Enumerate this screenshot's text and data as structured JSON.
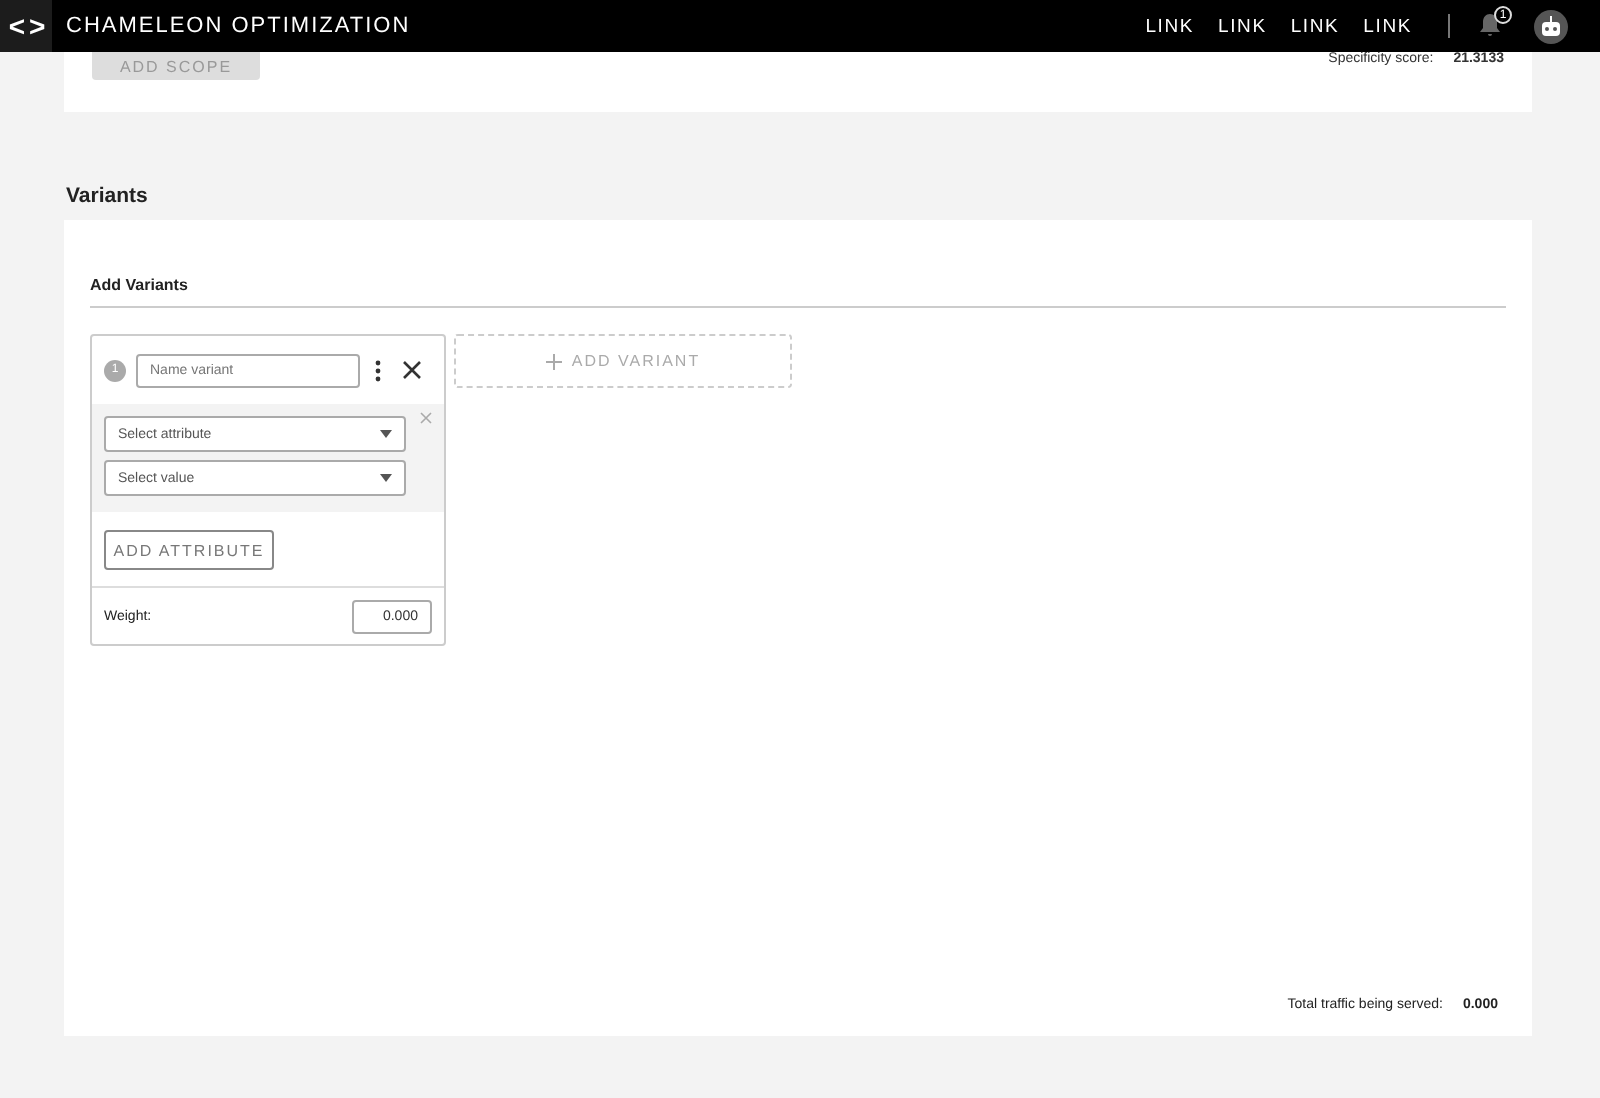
{
  "header": {
    "logo": "< >",
    "title": "CHAMELEON OPTIMIZATION",
    "links": [
      "LINK",
      "LINK",
      "LINK",
      "LINK"
    ],
    "notification_badge": "1"
  },
  "scope": {
    "add_scope_button": "ADD SCOPE",
    "specificity_label": "Specificity score:",
    "specificity_value": "21.3133"
  },
  "variants": {
    "heading": "Variants",
    "subheading": "Add Variants",
    "cards": [
      {
        "number": "1",
        "name_placeholder": "Name variant",
        "attributes": [
          {
            "attribute_placeholder": "Select attribute",
            "value_placeholder": "Select value"
          }
        ],
        "add_attribute_button": "ADD ATTRIBUTE",
        "weight_label": "Weight:",
        "weight_value": "0.000"
      }
    ],
    "add_variant_button": "ADD VARIANT",
    "total_label": "Total traffic being served:",
    "total_value": "0.000"
  }
}
